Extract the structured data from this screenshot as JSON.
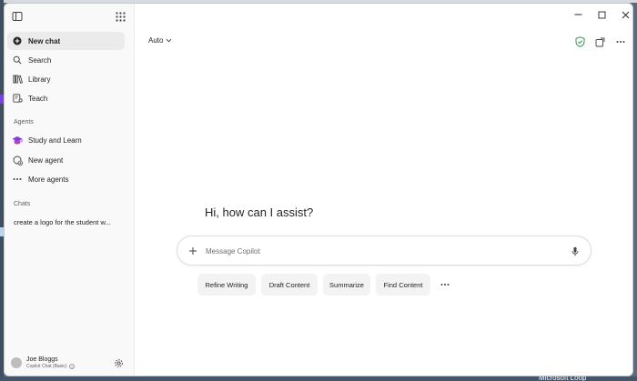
{
  "sidebar": {
    "nav": [
      {
        "label": "New chat",
        "icon": "new-chat-plus-icon"
      },
      {
        "label": "Search",
        "icon": "search-icon"
      },
      {
        "label": "Library",
        "icon": "library-icon"
      },
      {
        "label": "Teach",
        "icon": "teach-icon"
      }
    ],
    "agents_heading": "Agents",
    "agents": [
      {
        "label": "Study and Learn",
        "icon": "graduation-cap-icon"
      },
      {
        "label": "New agent",
        "icon": "new-agent-icon"
      },
      {
        "label": "More agents",
        "icon": "more-dots-icon"
      }
    ],
    "chats_heading": "Chats",
    "chats": [
      {
        "label": "create a logo for the student w..."
      }
    ],
    "profile": {
      "name": "Joe Bloggs",
      "subtitle": "Copilot Chat (Basic)"
    }
  },
  "header": {
    "model_label": "Auto"
  },
  "main": {
    "greeting": "Hi, how can I assist?",
    "composer_placeholder": "Message Copilot",
    "suggestions": [
      {
        "label": "Refine Writing"
      },
      {
        "label": "Draft Content"
      },
      {
        "label": "Summarize"
      },
      {
        "label": "Find Content"
      }
    ]
  },
  "desktop": {
    "partial_label": "Microsoft Loop"
  },
  "colors": {
    "accent_purple": "#7b3fe4",
    "shield_green": "#2e9b4e",
    "sidebar_bg": "#f9f9f9",
    "active_item_bg": "#ebebeb"
  }
}
